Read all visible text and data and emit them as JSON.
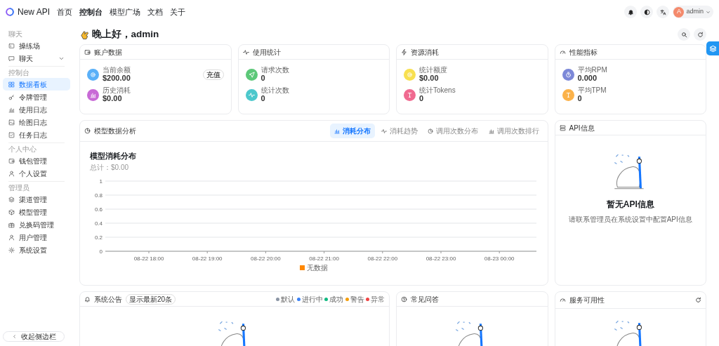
{
  "header": {
    "brand": "New API",
    "nav": [
      {
        "label": "首页",
        "selected": false
      },
      {
        "label": "控制台",
        "selected": true
      },
      {
        "label": "模型广场",
        "selected": false
      },
      {
        "label": "文档",
        "selected": false
      },
      {
        "label": "关于",
        "selected": false
      }
    ],
    "user": {
      "avatar_letter": "A",
      "name": "admin"
    }
  },
  "sidebar": {
    "groups": [
      {
        "title": "聊天",
        "items": [
          {
            "label": "操练场",
            "selected": false
          },
          {
            "label": "聊天",
            "selected": false,
            "expanded": false
          }
        ]
      },
      {
        "title": "控制台",
        "items": [
          {
            "label": "数据看板",
            "selected": true
          },
          {
            "label": "令牌管理",
            "selected": false
          },
          {
            "label": "使用日志",
            "selected": false
          },
          {
            "label": "绘图日志",
            "selected": false
          },
          {
            "label": "任务日志",
            "selected": false
          }
        ]
      },
      {
        "title": "个人中心",
        "items": [
          {
            "label": "钱包管理",
            "selected": false
          },
          {
            "label": "个人设置",
            "selected": false
          }
        ]
      },
      {
        "title": "管理员",
        "items": [
          {
            "label": "渠道管理",
            "selected": false
          },
          {
            "label": "模型管理",
            "selected": false
          },
          {
            "label": "兑换码管理",
            "selected": false
          },
          {
            "label": "用户管理",
            "selected": false
          },
          {
            "label": "系统设置",
            "selected": false
          }
        ]
      }
    ],
    "collapse_button": "收起侧边栏"
  },
  "greeting": "晚上好，admin",
  "stat_cards": [
    {
      "title": "账户数据",
      "items": [
        {
          "label": "当前余额",
          "value": "$200.00",
          "color": "#5ab0f8",
          "action": "充值"
        },
        {
          "label": "历史消耗",
          "value": "$0.00",
          "color": "#c86ad6"
        }
      ]
    },
    {
      "title": "使用统计",
      "items": [
        {
          "label": "请求次数",
          "value": "0",
          "color": "#5cc878"
        },
        {
          "label": "统计次数",
          "value": "0",
          "color": "#4cc8cc"
        }
      ]
    },
    {
      "title": "资源消耗",
      "items": [
        {
          "label": "统计额度",
          "value": "$0.00",
          "color": "#f8e050"
        },
        {
          "label": "统计Tokens",
          "value": "0",
          "color": "#f06a90"
        }
      ]
    },
    {
      "title": "性能指标",
      "items": [
        {
          "label": "平均RPM",
          "value": "0.000",
          "color": "#7c88d8"
        },
        {
          "label": "平均TPM",
          "value": "0",
          "color": "#fbb24a"
        }
      ]
    }
  ],
  "analysis": {
    "title": "模型数据分析",
    "tabs": [
      {
        "label": "消耗分布",
        "selected": true
      },
      {
        "label": "消耗趋势",
        "selected": false
      },
      {
        "label": "调用次数分布",
        "selected": false
      },
      {
        "label": "调用次数排行",
        "selected": false
      }
    ],
    "chart_title": "模型消耗分布",
    "chart_subtitle": "总计：$0.00",
    "chart_data": {
      "type": "bar",
      "grid": true,
      "categories": [
        "08-22 18:00",
        "08-22 19:00",
        "08-22 20:00",
        "08-22 21:00",
        "08-22 22:00",
        "08-22 23:00",
        "08-23 00:00"
      ],
      "ylim": [
        0,
        1
      ],
      "yticks": [
        0,
        0.2,
        0.4,
        0.6,
        0.8,
        1
      ],
      "series": [
        {
          "name": "无数据",
          "color": "#ff8800",
          "values": [
            null,
            null,
            null,
            null,
            null,
            null,
            null
          ]
        }
      ]
    }
  },
  "api_info": {
    "title": "API信息",
    "empty_title": "暂无API信息",
    "empty_text": "请联系管理员在系统设置中配置API信息"
  },
  "announcements": {
    "title": "系统公告",
    "badge": "显示最新20条",
    "legend": [
      {
        "label": "默认",
        "color": "#8b95a5"
      },
      {
        "label": "进行中",
        "color": "#3b82f6"
      },
      {
        "label": "成功",
        "color": "#10b981"
      },
      {
        "label": "警告",
        "color": "#f59e0b"
      },
      {
        "label": "异常",
        "color": "#ef4444"
      }
    ]
  },
  "faq": {
    "title": "常见问答"
  },
  "uptime": {
    "title": "服务可用性"
  }
}
